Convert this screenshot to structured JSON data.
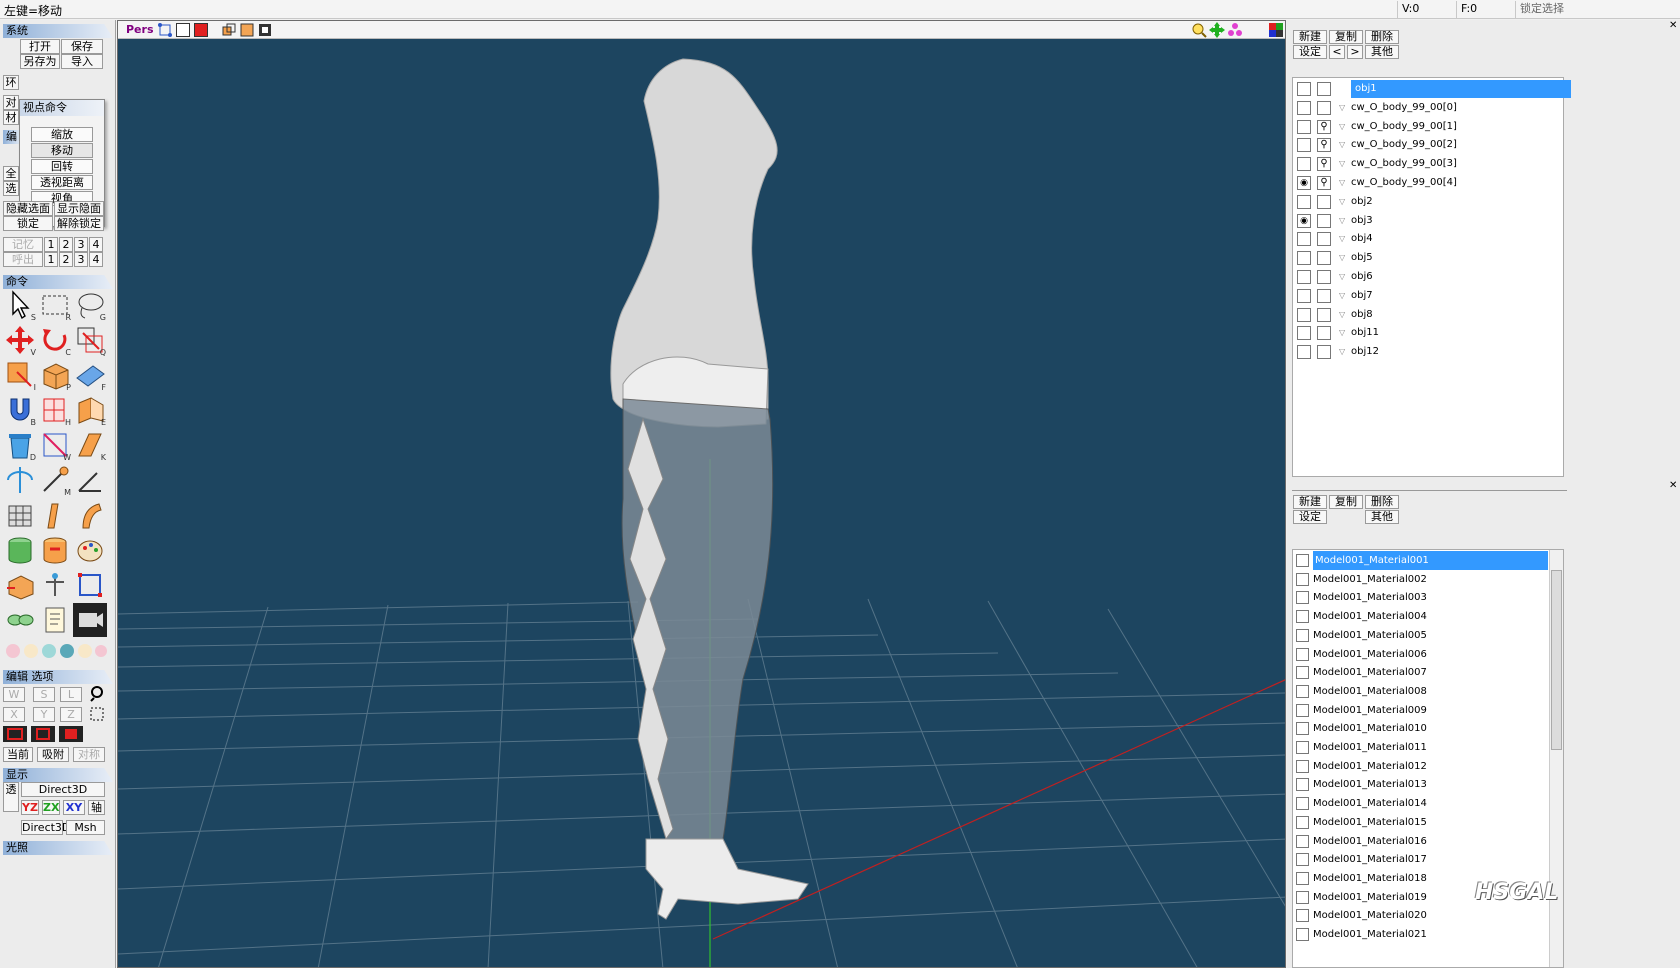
{
  "status": {
    "hint": "左键=移动",
    "v": "V:0",
    "f": "F:0",
    "lock": "锁定选择"
  },
  "left": {
    "system_title": "系统",
    "open": "打开",
    "save": "保存",
    "save_as": "另存为",
    "import": "导入",
    "popup": {
      "title": "视点命令",
      "items": [
        "缩放",
        "移动",
        "回转",
        "透视距离",
        "视角"
      ]
    },
    "hide_faces": "隐藏选面",
    "show_hidden": "显示隐面",
    "lock": "锁定",
    "unlock": "解除锁定",
    "memory": "记忆",
    "recall": "呼出",
    "slots": [
      "1",
      "2",
      "3",
      "4"
    ],
    "command_title": "命令",
    "edit_opt_title": "编辑 选项",
    "axes": [
      "W",
      "S",
      "L",
      "X",
      "Y",
      "Z"
    ],
    "current": "当前",
    "snap": "吸附",
    "symmetry": "对称",
    "display_title": "显示",
    "direct3d": "Direct3D",
    "yz": "YZ",
    "zx": "ZX",
    "xy": "XY",
    "axis": "轴",
    "direct3d_2": "Direct3D",
    "msh": "Msh",
    "light_title": "光照",
    "side_labels": [
      "环",
      "对",
      "材",
      "编",
      "全",
      "选",
      "透"
    ]
  },
  "viewport": {
    "mode": "Pers"
  },
  "right": {
    "new": "新建",
    "copy": "复制",
    "delete": "删除",
    "settings": "设定",
    "prev": "<",
    "next": ">",
    "other": "其他",
    "objects": [
      {
        "name": "obj1",
        "selected": true,
        "eye": false,
        "lock": false
      },
      {
        "name": "cw_O_body_99_00[0]",
        "eye": false,
        "lock": false
      },
      {
        "name": "cw_O_body_99_00[1]",
        "eye": false,
        "lock": true
      },
      {
        "name": "cw_O_body_99_00[2]",
        "eye": false,
        "lock": true
      },
      {
        "name": "cw_O_body_99_00[3]",
        "eye": false,
        "lock": true
      },
      {
        "name": "cw_O_body_99_00[4]",
        "eye": true,
        "lock": true
      },
      {
        "name": "obj2",
        "eye": false,
        "lock": false
      },
      {
        "name": "obj3",
        "eye": true,
        "lock": false
      },
      {
        "name": "obj4",
        "eye": false,
        "lock": false
      },
      {
        "name": "obj5",
        "eye": false,
        "lock": false
      },
      {
        "name": "obj6",
        "eye": false,
        "lock": false
      },
      {
        "name": "obj7",
        "eye": false,
        "lock": false
      },
      {
        "name": "obj8",
        "eye": false,
        "lock": false
      },
      {
        "name": "obj11",
        "eye": false,
        "lock": false
      },
      {
        "name": "obj12",
        "eye": false,
        "lock": false
      }
    ],
    "mat_new": "新建",
    "mat_copy": "复制",
    "mat_delete": "删除",
    "mat_settings": "设定",
    "mat_other": "其他",
    "materials": [
      "Model001_Material001",
      "Model001_Material002",
      "Model001_Material003",
      "Model001_Material004",
      "Model001_Material005",
      "Model001_Material006",
      "Model001_Material007",
      "Model001_Material008",
      "Model001_Material009",
      "Model001_Material010",
      "Model001_Material011",
      "Model001_Material012",
      "Model001_Material013",
      "Model001_Material014",
      "Model001_Material015",
      "Model001_Material016",
      "Model001_Material017",
      "Model001_Material018",
      "Model001_Material019",
      "Model001_Material020",
      "Model001_Material021"
    ]
  },
  "watermark": "HSGAL",
  "colors": {
    "viewport_bg": "#1d4560",
    "selection": "#3399ff",
    "grid": "#5f7c8f"
  }
}
